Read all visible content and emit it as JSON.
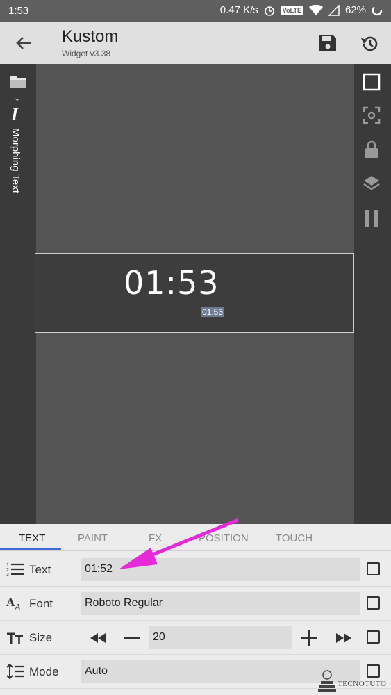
{
  "status_bar": {
    "time": "1:53",
    "net_speed": "0.47 K/s",
    "volte": "VoLTE",
    "battery": "62%"
  },
  "app_bar": {
    "title": "Kustom",
    "subtitle": "Widget v3.38"
  },
  "left_panel": {
    "label": "Morphing Text"
  },
  "canvas": {
    "big_time": "01:53",
    "small_time": "01:53"
  },
  "tabs": [
    {
      "label": "TEXT",
      "active": true
    },
    {
      "label": "PAINT",
      "active": false
    },
    {
      "label": "FX",
      "active": false
    },
    {
      "label": "POSITION",
      "active": false
    },
    {
      "label": "TOUCH",
      "active": false
    }
  ],
  "properties": {
    "text": {
      "label": "Text",
      "value": "01:52"
    },
    "font": {
      "label": "Font",
      "value": "Roboto Regular"
    },
    "size": {
      "label": "Size",
      "value": "20"
    },
    "mode": {
      "label": "Mode",
      "value": "Auto"
    }
  },
  "watermark": "TECNOTUTO",
  "colors": {
    "accent": "#3f6ad8",
    "annotation_arrow": "#e62ad8"
  }
}
